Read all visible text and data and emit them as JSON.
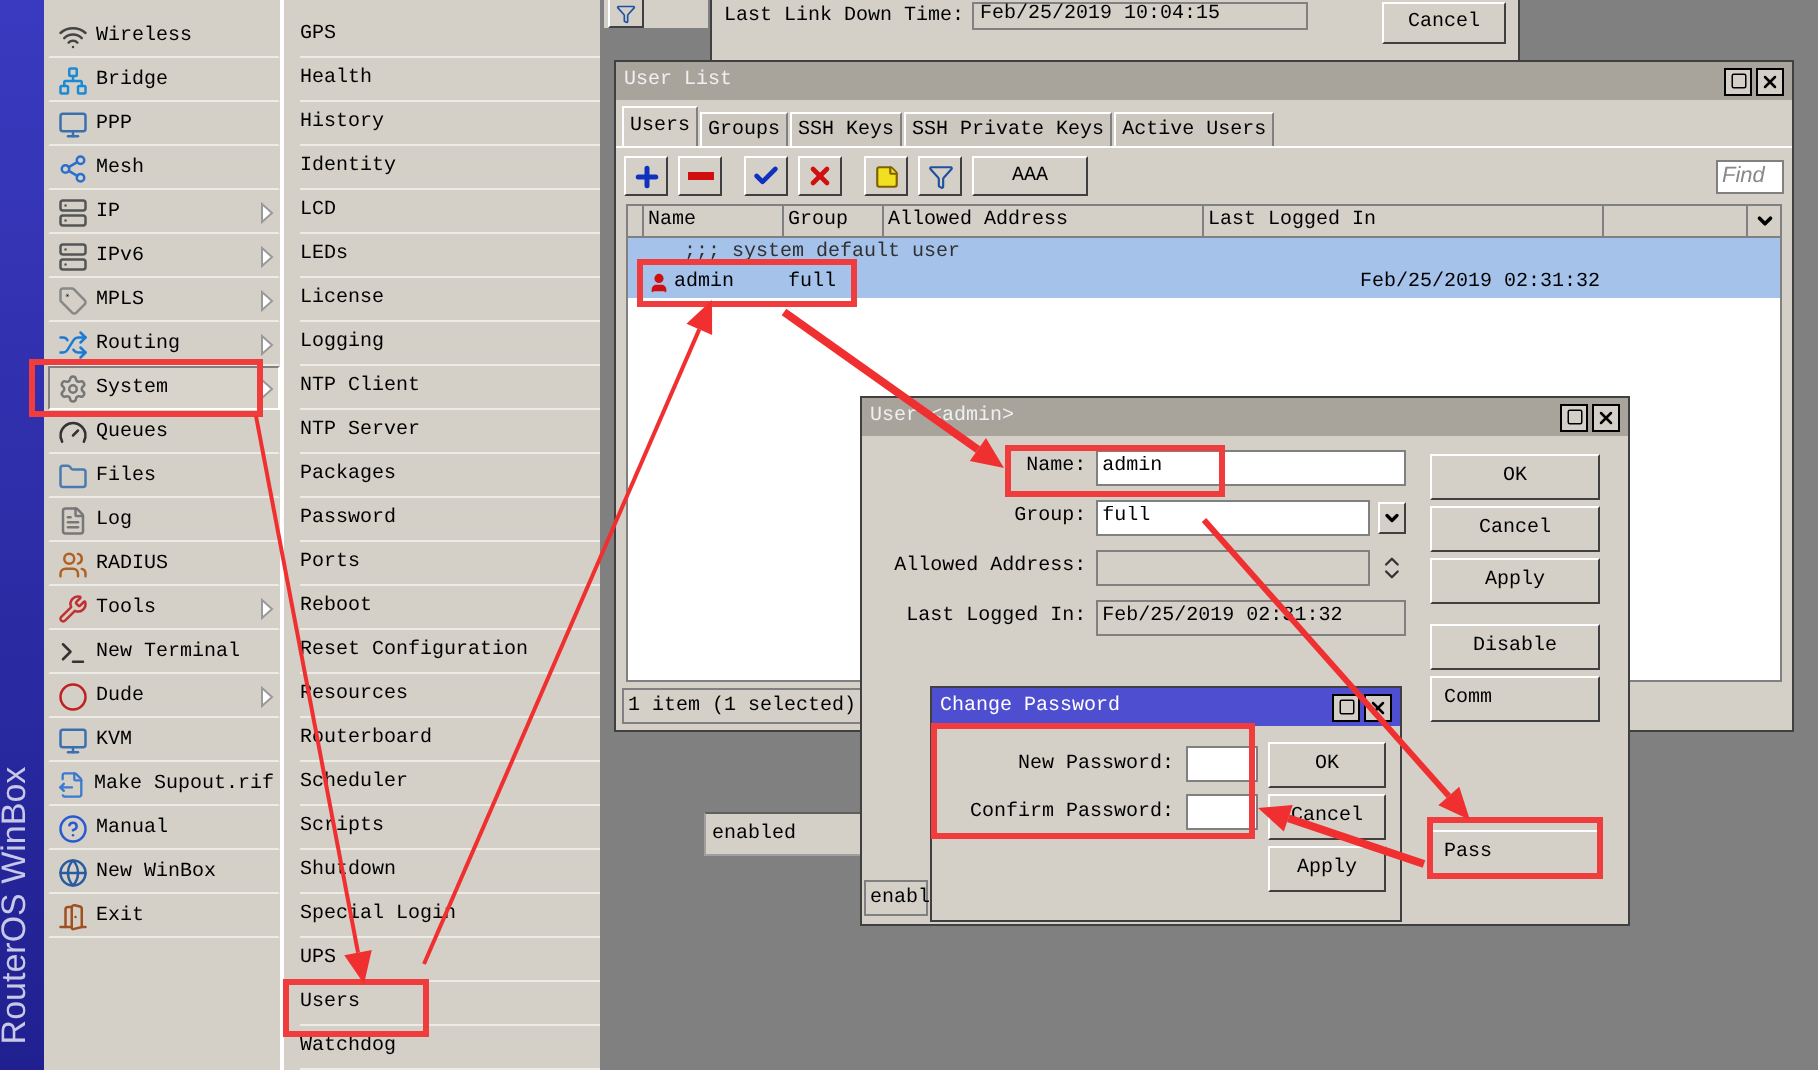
{
  "sidebar": {
    "brand": "RouterOS WinBox",
    "items": [
      {
        "label": "Wireless",
        "submenu": false,
        "selected": false
      },
      {
        "label": "Bridge",
        "submenu": false,
        "selected": false
      },
      {
        "label": "PPP",
        "submenu": false,
        "selected": false
      },
      {
        "label": "Mesh",
        "submenu": false,
        "selected": false
      },
      {
        "label": "IP",
        "submenu": true,
        "selected": false
      },
      {
        "label": "IPv6",
        "submenu": true,
        "selected": false
      },
      {
        "label": "MPLS",
        "submenu": true,
        "selected": false
      },
      {
        "label": "Routing",
        "submenu": true,
        "selected": false
      },
      {
        "label": "System",
        "submenu": true,
        "selected": true
      },
      {
        "label": "Queues",
        "submenu": false,
        "selected": false
      },
      {
        "label": "Files",
        "submenu": false,
        "selected": false
      },
      {
        "label": "Log",
        "submenu": false,
        "selected": false
      },
      {
        "label": "RADIUS",
        "submenu": false,
        "selected": false
      },
      {
        "label": "Tools",
        "submenu": true,
        "selected": false
      },
      {
        "label": "New Terminal",
        "submenu": false,
        "selected": false
      },
      {
        "label": "Dude",
        "submenu": true,
        "selected": false
      },
      {
        "label": "KVM",
        "submenu": false,
        "selected": false
      },
      {
        "label": "Make Supout.rif",
        "submenu": false,
        "selected": false
      },
      {
        "label": "Manual",
        "submenu": false,
        "selected": false
      },
      {
        "label": "New WinBox",
        "submenu": false,
        "selected": false
      },
      {
        "label": "Exit",
        "submenu": false,
        "selected": false
      }
    ]
  },
  "submenu": {
    "items": [
      "GPS",
      "Health",
      "History",
      "Identity",
      "LCD",
      "LEDs",
      "License",
      "Logging",
      "NTP Client",
      "NTP Server",
      "Packages",
      "Password",
      "Ports",
      "Reboot",
      "Reset Configuration",
      "Resources",
      "Routerboard",
      "Scheduler",
      "Scripts",
      "Shutdown",
      "Special Login",
      "UPS",
      "Users",
      "Watchdog"
    ]
  },
  "back_window": {
    "field_label": "Last Link Down Time:",
    "field_value": "Feb/25/2019 10:04:15",
    "button": "Cancel"
  },
  "behind_field": "enabled",
  "user_list": {
    "title": "User List",
    "active": false,
    "tabs": [
      {
        "label": "Users",
        "selected": true
      },
      {
        "label": "Groups",
        "selected": false
      },
      {
        "label": "SSH Keys",
        "selected": false
      },
      {
        "label": "SSH Private Keys",
        "selected": false
      },
      {
        "label": "Active Users",
        "selected": false
      }
    ],
    "aaa_button": "AAA",
    "find_placeholder": "Find",
    "columns": [
      "Name",
      "Group",
      "Allowed Address",
      "Last Logged In"
    ],
    "rows": [
      {
        "kind": "comment",
        "text": ";;; system default user",
        "selected": true
      },
      {
        "kind": "user",
        "name": "admin",
        "group": "full",
        "last_logged_in": "Feb/25/2019 02:31:32",
        "selected": true
      }
    ],
    "status": "1 item (1 selected)"
  },
  "user_window": {
    "title": "User <admin>",
    "active": false,
    "fields": [
      {
        "kind": "text",
        "label": "Name:",
        "value": "admin"
      },
      {
        "kind": "select",
        "label": "Group:",
        "value": "full"
      },
      {
        "kind": "disabled",
        "label": "Allowed Address:"
      },
      {
        "kind": "readonly",
        "label": "Last Logged In:",
        "value": "Feb/25/2019 02:31:32"
      }
    ],
    "buttons": [
      "OK",
      "Cancel",
      "Apply",
      "Disable",
      "Comm",
      "Pass"
    ],
    "status": "enabl"
  },
  "change_password": {
    "title": "Change Password",
    "active": true,
    "fields": [
      {
        "label": "New Password:"
      },
      {
        "label": "Confirm Password:"
      }
    ],
    "buttons": [
      "OK",
      "Cancel",
      "Apply"
    ]
  }
}
